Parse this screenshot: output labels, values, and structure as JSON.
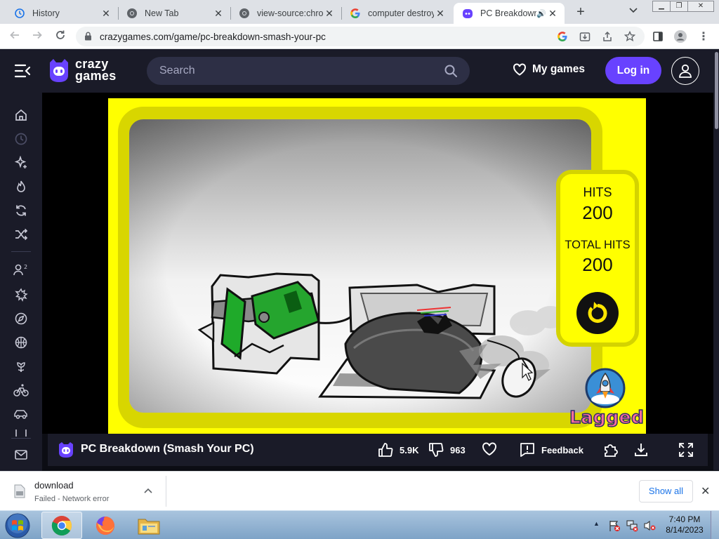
{
  "browser": {
    "tabs": [
      {
        "title": "History",
        "icon": "history-icon"
      },
      {
        "title": "New Tab",
        "icon": "chrome-icon"
      },
      {
        "title": "view-source:chrome",
        "icon": "chrome-icon"
      },
      {
        "title": "computer destroy",
        "icon": "google-icon"
      },
      {
        "title": "PC Breakdown",
        "icon": "crazygames-icon",
        "active": true
      }
    ],
    "url": "crazygames.com/game/pc-breakdown-smash-your-pc"
  },
  "header": {
    "logo_line1": "crazy",
    "logo_line2": "games",
    "search_placeholder": "Search",
    "my_games": "My games",
    "login": "Log in"
  },
  "game": {
    "hits_label": "HITS",
    "hits_value": "200",
    "total_hits_label": "TOTAL HITS",
    "total_hits_value": "200",
    "publisher": "Lagged"
  },
  "gamebar": {
    "title": "PC Breakdown (Smash Your PC)",
    "likes": "5.9K",
    "dislikes": "963",
    "feedback": "Feedback"
  },
  "downloads": {
    "filename": "download",
    "status": "Failed - Network error",
    "show_all": "Show all"
  },
  "taskbar": {
    "time": "7:40 PM",
    "date": "8/14/2023"
  },
  "colors": {
    "brand_purple": "#6842ff",
    "header_bg": "#1a1b28",
    "game_yellow": "#ffff00"
  }
}
